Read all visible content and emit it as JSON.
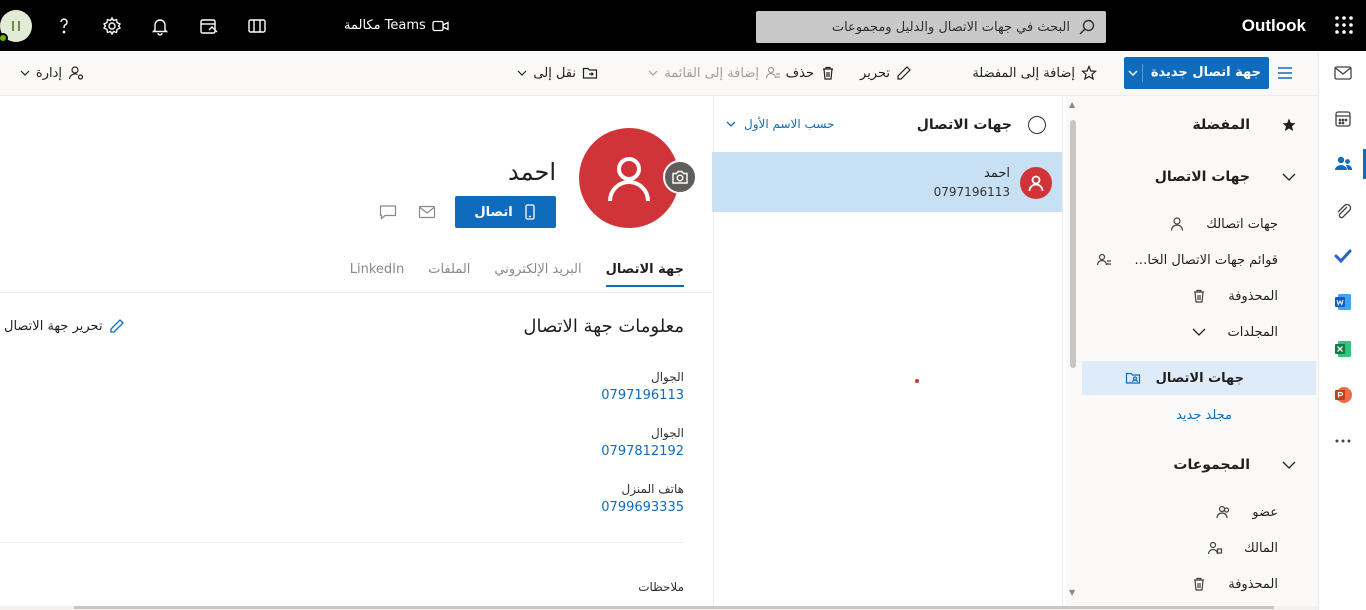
{
  "topbar": {
    "app_name": "Outlook",
    "search_placeholder": "البحث في جهات الاتصال والدليل ومجموعات",
    "meet_label": "مكالمة Teams"
  },
  "commandbar": {
    "new_contact": "جهة اتصال جديدة",
    "add_favorite": "إضافة إلى المفضلة",
    "edit": "تحرير",
    "delete": "حذف",
    "add_to_list": "إضافة إلى القائمة",
    "move_to": "نقل إلى",
    "manage": "إدارة"
  },
  "folders": {
    "favorites": "المفضلة",
    "contacts_header": "جهات الاتصال",
    "your_contacts": "جهات اتصالك",
    "contact_lists": "قوائم جهات الاتصال الخاص...",
    "deleted": "المحذوفة",
    "folders_header": "المجلدات",
    "selected_folder": "جهات الاتصال",
    "new_folder": "مجلد جديد",
    "groups_header": "المجموعات",
    "member": "عضو",
    "owner": "المالك",
    "groups_deleted": "المحذوفة"
  },
  "list": {
    "title": "جهات الاتصال",
    "sort": "حسب الاسم الأول",
    "items": [
      {
        "name": "احمد",
        "number": "0797196113"
      }
    ]
  },
  "contact": {
    "name": "احمد",
    "call_label": "اتصال",
    "tabs": [
      "جهة الاتصال",
      "البريد الإلكتروني",
      "الملفات",
      "LinkedIn"
    ],
    "section_title": "معلومات جهة الاتصال",
    "edit_label": "تحرير جهة الاتصال",
    "fields": [
      {
        "label": "الجوال",
        "value": "0797196113"
      },
      {
        "label": "الجوال",
        "value": "0797812192"
      },
      {
        "label": "هاتف المنزل",
        "value": "0799693335"
      }
    ],
    "notes_label": "ملاحظات"
  },
  "colors": {
    "accent": "#0f6cbd",
    "avatar": "#d13438",
    "topbar": "#000000"
  }
}
